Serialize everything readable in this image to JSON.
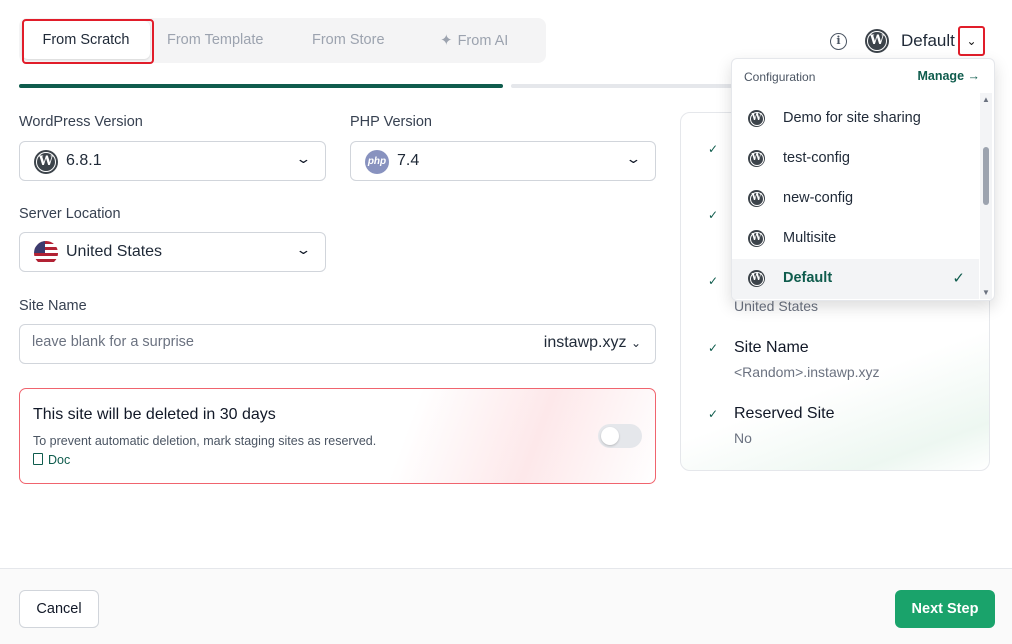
{
  "tabs": [
    {
      "label": "From Scratch",
      "active": true
    },
    {
      "label": "From Template"
    },
    {
      "label": "From Store"
    },
    {
      "label": "From AI",
      "icon": "sparkle-icon"
    }
  ],
  "top_right": {
    "config_name": "Default",
    "info_icon": "info-icon",
    "logo": "wordpress-logo-icon"
  },
  "form": {
    "wp_version_label": "WordPress Version",
    "wp_version_value": "6.8.1",
    "php_version_label": "PHP Version",
    "php_version_value": "7.4",
    "php_icon_text": "php",
    "server_location_label": "Server Location",
    "server_location_value": "United States",
    "site_name_label": "Site Name",
    "site_name_placeholder": "leave blank for a surprise",
    "site_name_value": "",
    "domain_value": "instawp.xyz"
  },
  "warning": {
    "title": "This site will be deleted in 30 days",
    "description": "To prevent automatic deletion, mark staging sites as reserved.",
    "doc_label": "Doc",
    "reserved_toggle": false
  },
  "summary": {
    "partial_value": "United States",
    "items": [
      {
        "title": "Site Name",
        "value": "<Random>.instawp.xyz"
      },
      {
        "title": "Reserved Site",
        "value": "No"
      }
    ]
  },
  "dropdown": {
    "header": "Configuration",
    "manage_label": "Manage →",
    "items": [
      {
        "label": "Demo for site sharing"
      },
      {
        "label": "test-config"
      },
      {
        "label": "new-config"
      },
      {
        "label": "Multisite"
      },
      {
        "label": "Default",
        "selected": true
      }
    ]
  },
  "footer": {
    "cancel_label": "Cancel",
    "next_label": "Next Step"
  },
  "colors": {
    "accent": "#0f5c4d",
    "primary_button": "#1aa36b",
    "warning_border": "#f0646e",
    "highlight": "#e11d2a"
  }
}
